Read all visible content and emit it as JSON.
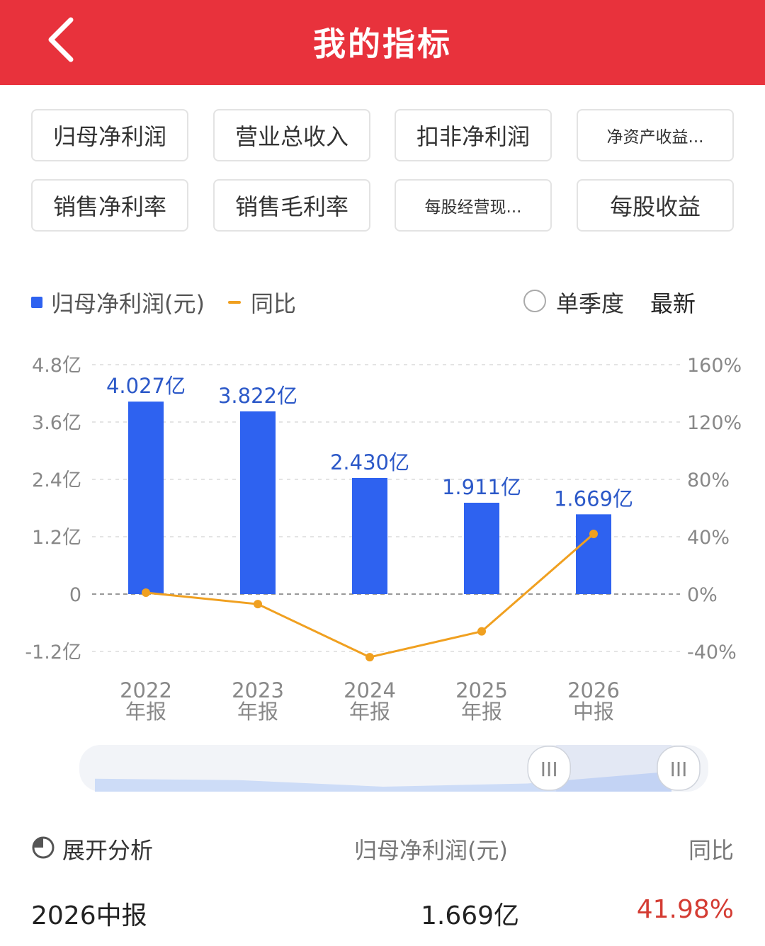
{
  "header": {
    "title": "我的指标"
  },
  "tabs": [
    {
      "label": "归母净利润",
      "active": true
    },
    {
      "label": "营业总收入",
      "active": false
    },
    {
      "label": "扣非净利润",
      "active": false
    },
    {
      "label": "净资产收益...",
      "active": false
    },
    {
      "label": "销售净利率",
      "active": false
    },
    {
      "label": "销售毛利率",
      "active": false
    },
    {
      "label": "每股经营现...",
      "active": false
    },
    {
      "label": "每股收益",
      "active": false
    }
  ],
  "legend": {
    "series1": "归母净利润(元)",
    "series2": "同比",
    "quarter_toggle": "单季度",
    "latest": "最新"
  },
  "colors": {
    "header": "#e8323c",
    "bar": "#2e62f0",
    "line": "#f0a020",
    "negative_yoy": "#d43c33"
  },
  "chart_data": {
    "type": "bar",
    "categories": [
      "2022\n年报",
      "2023\n年报",
      "2024\n年报",
      "2025\n年报",
      "2026\n中报"
    ],
    "series": [
      {
        "name": "归母净利润(元)",
        "type": "bar",
        "values": [
          4.027,
          3.822,
          2.43,
          1.911,
          1.669
        ],
        "labels": [
          "4.027亿",
          "3.822亿",
          "2.430亿",
          "1.911亿",
          "1.669亿"
        ]
      },
      {
        "name": "同比",
        "type": "line",
        "axis": "right",
        "values": [
          1,
          -7,
          -44,
          -26,
          41.98
        ]
      }
    ],
    "y_left": {
      "ylim": [
        -1.2,
        4.8
      ],
      "ticks": [
        "4.8亿",
        "3.6亿",
        "2.4亿",
        "1.2亿",
        "0",
        "-1.2亿"
      ]
    },
    "y_right": {
      "ylim": [
        -40,
        160
      ],
      "ticks": [
        "160%",
        "120%",
        "80%",
        "40%",
        "0%",
        "-40%"
      ]
    },
    "grid": true
  },
  "slider": {
    "range_start": 0.8,
    "range_end": 1.0,
    "handle_glyph": "III"
  },
  "analysis": {
    "label": "展开分析",
    "col_value": "归母净利润(元)",
    "col_yoy": "同比",
    "row_period": "2026中报",
    "row_value": "1.669亿",
    "row_yoy": "41.98%"
  }
}
